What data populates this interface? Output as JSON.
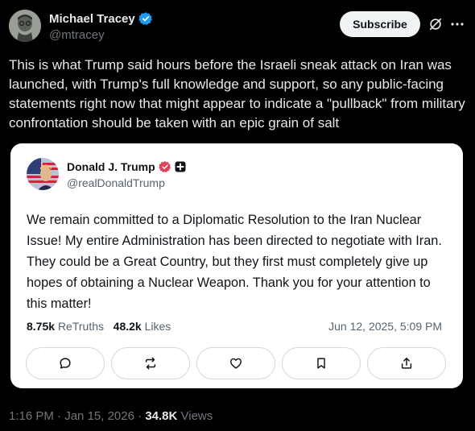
{
  "post": {
    "author_name": "Michael Tracey",
    "author_handle": "@mtracey",
    "subscribe_label": "Subscribe",
    "more_label": "···",
    "text": "This is what Trump said hours before the Israeli sneak attack on Iran was launched, with Trump's full knowledge and support, so any public-facing statements right now that might appear to indicate a \"pullback\" from military confrontation should be taken with an epic grain of salt",
    "time": "1:16 PM",
    "sep1": " · ",
    "date": "Jan 15, 2026",
    "sep2": " · ",
    "views_count": "34.8K",
    "views_label": " Views",
    "verified_color": "#1d9bf0"
  },
  "card": {
    "author_name": "Donald J. Trump",
    "author_handle": "@realDonaldTrump",
    "text": "We remain committed to a Diplomatic Resolution to the Iran Nuclear Issue! My entire Administration has been directed to negotiate with Iran. They could be a Great Country, but they first must completely give up hopes of obtaining a Nuclear Weapon. Thank you for your attention to this matter!",
    "retruths_count": "8.75k",
    "retruths_label": "ReTruths",
    "likes_count": "48.2k",
    "likes_label": "Likes",
    "date": "Jun 12, 2025, 5:09 PM",
    "verified_color": "#e2435b",
    "actions": [
      "comment-icon",
      "retruth-icon",
      "like-icon",
      "bookmark-icon",
      "share-icon"
    ]
  }
}
